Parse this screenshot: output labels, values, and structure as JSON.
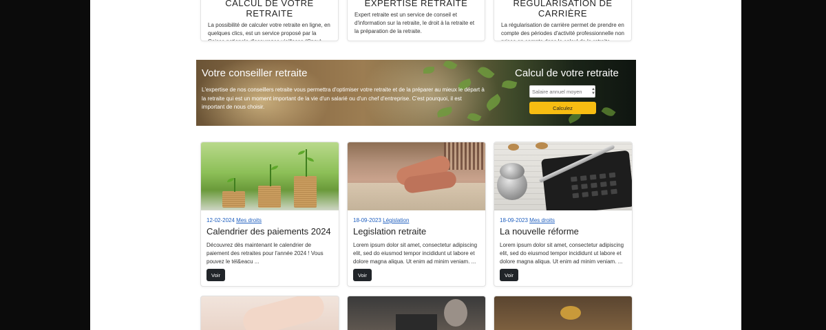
{
  "services": [
    {
      "title": "CALCUL DE VOTRE RETRAITE",
      "text": "La possibilité de calculer votre retraite en ligne, en quelques clics, est un service proposé par la Caisse nationale d'assurance vieillesse (Cnav)."
    },
    {
      "title": "EXPERTISE RETRAITE",
      "text": "Expert retraite est un service de conseil et d'information sur la retraite, le droit à la retraite et la préparation de la retraite."
    },
    {
      "title": "RÉGULARISATION DE CARRIÈRE",
      "text": "La régularisation de carrière permet de prendre en compte des périodes d'activité professionnelle non prises en compte dans le calcul de la retraite."
    }
  ],
  "banner": {
    "title": "Votre conseiller retraite",
    "description": "L'expertise de nos conseillers retraite vous permettra d'optimiser votre retraite et de la préparer au mieux le départ à la retraite qui est un moment important de la vie d'un salarié ou d'un chef d'entreprise. C'est pourquoi, il est important de nous choisir.",
    "calc_title": "Calcul de votre retraite",
    "input_placeholder": "Salaire annuel moyen",
    "button_label": "Calculez"
  },
  "articles": [
    {
      "date": "12-02-2024",
      "category": "Mes droits",
      "title": "Calendrier des paiements 2024",
      "excerpt": "Découvrez dès maintenant le calendrier de paiement des retraites pour l'année 2024 ! Vous pouvez le tél&eacu ...",
      "button": "Voir",
      "image": "coins-plants"
    },
    {
      "date": "18-09-2023",
      "category": "Législation",
      "title": "Legislation retraite",
      "excerpt": "Lorem ipsum dolor sit amet, consectetur adipiscing elit, sed do eiusmod tempor incididunt ut labore et dolore magna aliqua. Ut enim ad minim veniam. ...",
      "button": "Voir",
      "image": "elderly-hands"
    },
    {
      "date": "18-09-2023",
      "category": "Mes droits",
      "title": "La nouvelle réforme",
      "excerpt": "Lorem ipsum dolor sit amet, consectetur adipiscing elit, sed do eiusmod tempor incididunt ut labore et dolore magna aliqua. Ut enim ad minim veniam. ...",
      "button": "Voir",
      "image": "calculator-coins"
    }
  ],
  "colors": {
    "accent_yellow": "#f7bd12",
    "link_blue": "#1f5fbf",
    "button_dark": "#212529"
  }
}
